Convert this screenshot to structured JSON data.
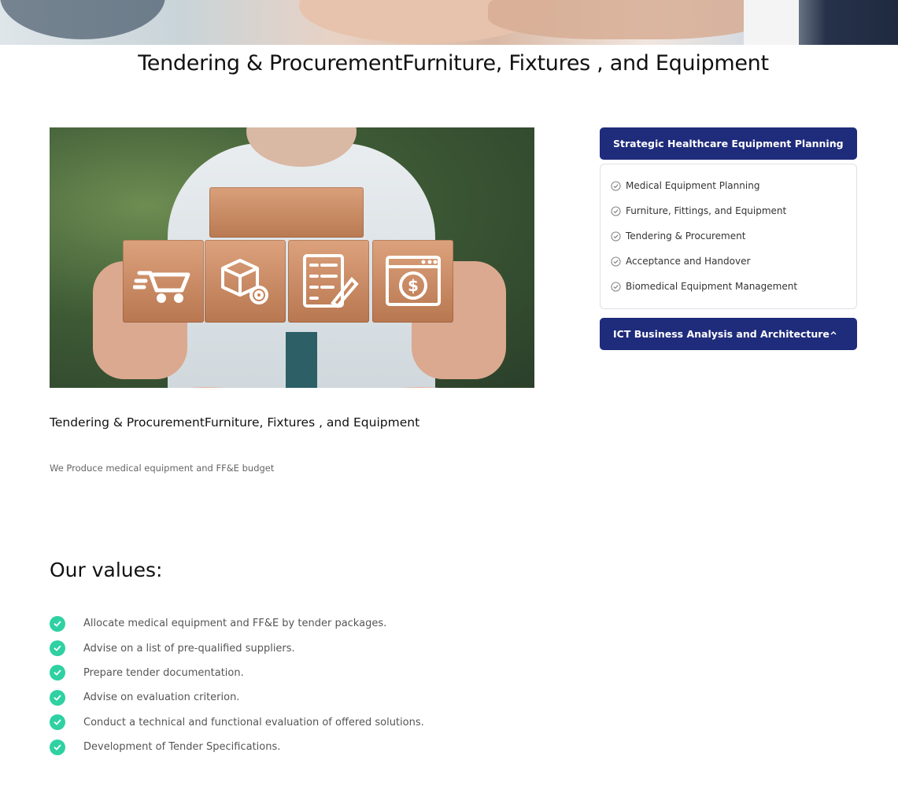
{
  "page": {
    "title": "Tendering & ProcurementFurniture, Fixtures , and Equipment"
  },
  "content": {
    "subtitle": "Tendering & ProcurementFurniture, Fixtures , and Equipment",
    "lead": "We Produce medical equipment and FF&E budget"
  },
  "sidebar": {
    "sections": [
      {
        "title": "Strategic Healthcare Equipment Planning",
        "expanded": true,
        "items": [
          "Medical Equipment Planning",
          "Furniture, Fittings, and Equipment",
          "Tendering & Procurement",
          "Acceptance and Handover",
          "Biomedical Equipment Management"
        ]
      },
      {
        "title": "ICT Business Analysis and Architecture",
        "expanded": false,
        "items": []
      }
    ]
  },
  "values": {
    "title": "Our values:",
    "items": [
      "Allocate medical equipment and FF&E by tender packages.",
      "Advise on a list of pre-qualified suppliers.",
      "Prepare tender documentation.",
      "Advise on evaluation criterion.",
      "Conduct a technical and functional evaluation of offered solutions.",
      "Development of Tender Specifications."
    ]
  },
  "colors": {
    "accordion_header": "#1f2b7b",
    "check_accent": "#2fd1a2"
  },
  "icons": {
    "hero_image": "handshake-photo",
    "main_image": "wooden-blocks-photo",
    "blocks": [
      "shopping-cart-icon",
      "package-gear-icon",
      "checklist-icon",
      "payment-window-icon"
    ]
  }
}
